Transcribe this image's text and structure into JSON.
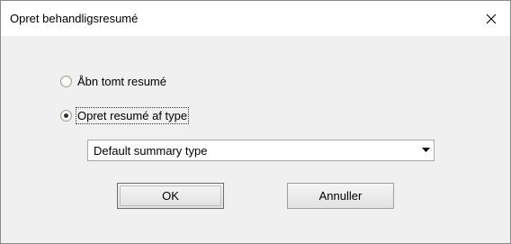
{
  "window": {
    "title": "Opret behandligsresumé",
    "close_icon": "close-icon"
  },
  "options": {
    "empty_label": "Åbn tomt resumé",
    "empty_checked": false,
    "by_type_label": "Opret resumé af type",
    "by_type_checked": true
  },
  "summary_type": {
    "selected": "Default summary type",
    "arrow_icon": "chevron-down-icon"
  },
  "buttons": {
    "ok_label": "OK",
    "cancel_label": "Annuller"
  }
}
